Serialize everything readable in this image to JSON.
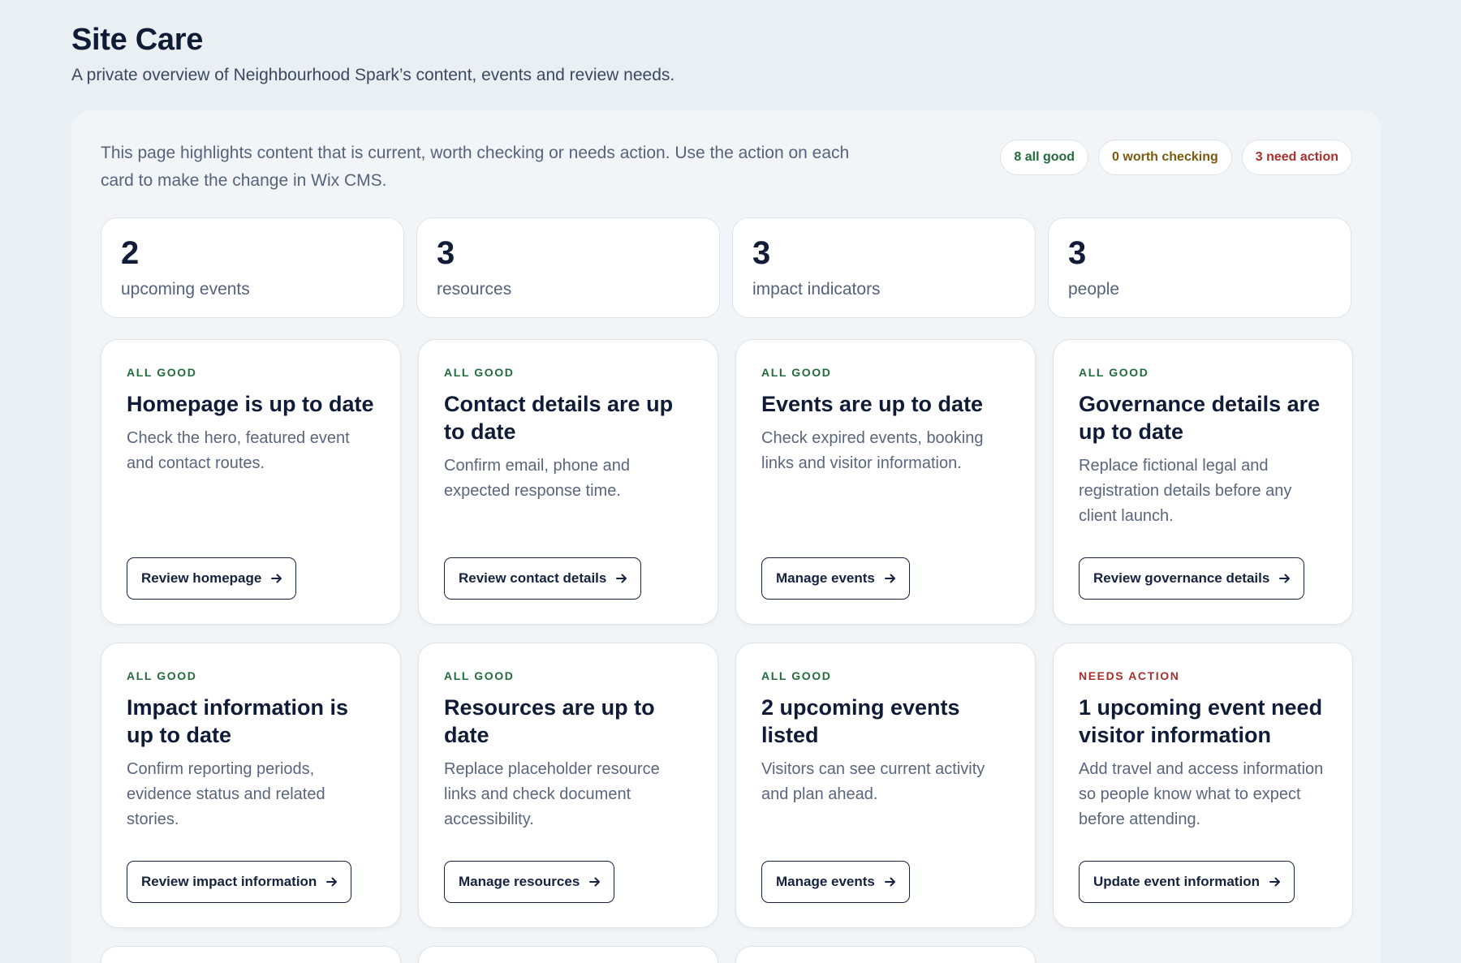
{
  "header": {
    "title": "Site Care",
    "subtitle": "A private overview of Neighbourhood Spark’s content, events and review needs."
  },
  "panel": {
    "intro": "This page highlights content that is current, worth checking or needs action. Use the action on each card to make the change in Wix CMS.",
    "pills": {
      "good": "8 all good",
      "check": "0 worth checking",
      "action": "3 need action"
    }
  },
  "stats": [
    {
      "value": "2",
      "label": "upcoming events"
    },
    {
      "value": "3",
      "label": "resources"
    },
    {
      "value": "3",
      "label": "impact indicators"
    },
    {
      "value": "3",
      "label": "people"
    }
  ],
  "cards": [
    {
      "status": "ALL GOOD",
      "title": "Homepage is up to date",
      "desc": "Check the hero, featured event and contact routes.",
      "action": "Review homepage"
    },
    {
      "status": "ALL GOOD",
      "title": "Contact details are up to date",
      "desc": "Confirm email, phone and expected response time.",
      "action": "Review contact details"
    },
    {
      "status": "ALL GOOD",
      "title": "Events are up to date",
      "desc": "Check expired events, booking links and visitor information.",
      "action": "Manage events"
    },
    {
      "status": "ALL GOOD",
      "title": "Governance details are up to date",
      "desc": "Replace fictional legal and registration details before any client launch.",
      "action": "Review governance details"
    },
    {
      "status": "ALL GOOD",
      "title": "Impact information is up to date",
      "desc": "Confirm reporting periods, evidence status and related stories.",
      "action": "Review impact information"
    },
    {
      "status": "ALL GOOD",
      "title": "Resources are up to date",
      "desc": "Replace placeholder resource links and check document accessibility.",
      "action": "Manage resources"
    },
    {
      "status": "ALL GOOD",
      "title": "2 upcoming events listed",
      "desc": "Visitors can see current activity and plan ahead.",
      "action": "Manage events"
    },
    {
      "status": "NEEDS ACTION",
      "title": "1 upcoming event need visitor information",
      "desc": "Add travel and access information so people know what to expect before attending.",
      "action": "Update event information"
    }
  ],
  "colors": {
    "good": "#226b3c",
    "check": "#7a5a0f",
    "action": "#a8302c",
    "ink": "#15233f"
  }
}
